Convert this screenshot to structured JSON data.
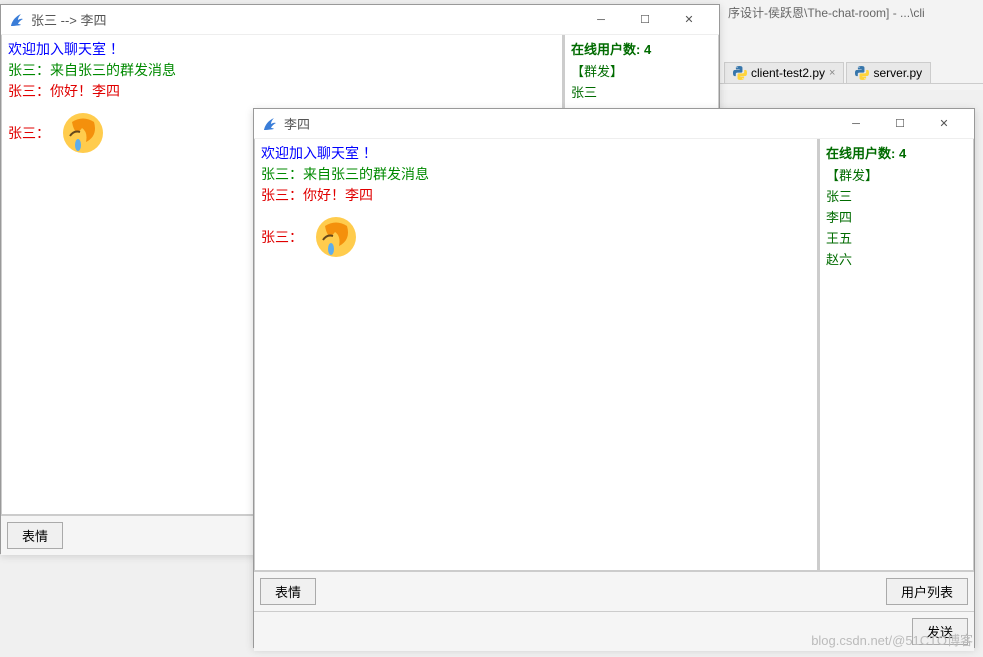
{
  "window1": {
    "title": "张三  -->  李四",
    "messages": {
      "welcome": "欢迎加入聊天室 ！",
      "msg1": "张三：来自张三的群发消息",
      "msg2": "张三：你好！李四",
      "emoji_sender": "张三："
    },
    "sidebar": {
      "online_count": "在线用户数: 4",
      "broadcast": "【群发】",
      "users": [
        "张三"
      ]
    },
    "buttons": {
      "emoji": "表情"
    }
  },
  "window2": {
    "title": "李四",
    "messages": {
      "welcome": "欢迎加入聊天室 ！",
      "msg1": "张三：来自张三的群发消息",
      "msg2": "张三：你好！李四",
      "emoji_sender": "张三："
    },
    "sidebar": {
      "online_count": "在线用户数: 4",
      "broadcast": "【群发】",
      "users": [
        "张三",
        "李四",
        "王五",
        "赵六"
      ]
    },
    "buttons": {
      "emoji": "表情",
      "userlist": "用户列表",
      "send": "发送"
    }
  },
  "ide": {
    "title": "序设计-侯跃恩\\The-chat-room] - ...\\cli",
    "tabs": [
      {
        "label": "client-test2.py"
      },
      {
        "label": "server.py"
      }
    ]
  },
  "watermark": "blog.csdn.net/@51CTO博客"
}
